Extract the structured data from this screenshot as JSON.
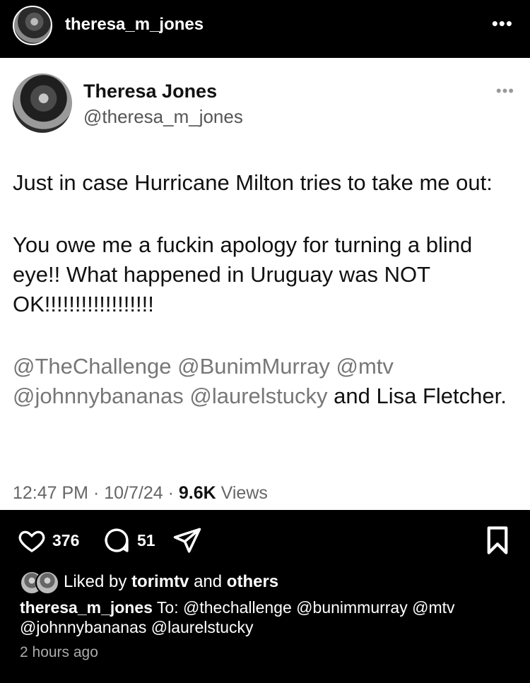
{
  "header": {
    "username": "theresa_m_jones",
    "more_icon": "more-horizontal-icon"
  },
  "tweet": {
    "name": "Theresa Jones",
    "handle": "@theresa_m_jones",
    "line1": "Just in case Hurricane Milton tries to take me out:",
    "line2": "You owe me a fuckin apology for turning a blind eye!! What happened in Uruguay was NOT OK!!!!!!!!!!!!!!!!!!",
    "mentions": "@TheChallenge @BunimMurray @mtv @johnnybananas @laurelstucky",
    "mentions_tail": " and Lisa Fletcher.",
    "time": "12:47 PM",
    "date": "10/7/24",
    "views_count": "9.6K",
    "views_label": "Views"
  },
  "actions": {
    "likes": "376",
    "comments": "51"
  },
  "liked_by": {
    "prefix": "Liked by",
    "user": "torimtv",
    "and": "and",
    "others": "others"
  },
  "caption": {
    "user": "theresa_m_jones",
    "text": "To: @thechallenge @bunimmurray @mtv @johnnybananas @laurelstucky"
  },
  "timestamp": "2 hours ago"
}
